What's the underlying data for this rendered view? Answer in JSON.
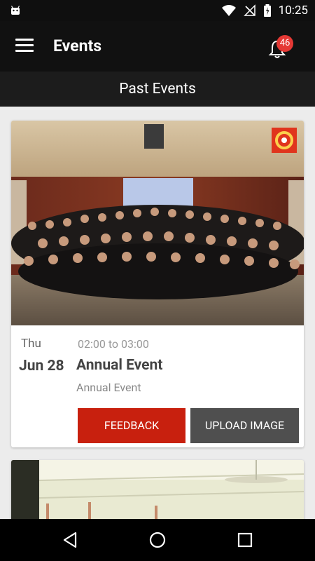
{
  "status_bar": {
    "time": "10:25",
    "icons": [
      "android-icon",
      "wifi-icon",
      "no-signal-icon",
      "battery-charging-icon"
    ]
  },
  "app_bar": {
    "title": "Events",
    "notification_count": "46"
  },
  "section": {
    "title": "Past Events"
  },
  "events": [
    {
      "day": "Thu",
      "date": "Jun 28",
      "time": "02:00 to 03:00",
      "title": "Annual Event",
      "subtitle": "Annual Event",
      "feedback_label": "FEEDBACK",
      "upload_label": "UPLOAD IMAGE"
    }
  ],
  "colors": {
    "app_bar": "#111111",
    "feedback_button": "#c8200e",
    "upload_button": "#4f4f4f",
    "badge": "#e53935"
  }
}
